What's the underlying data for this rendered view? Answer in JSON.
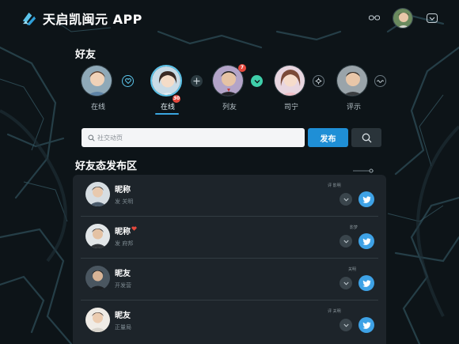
{
  "app": {
    "title": "天启凯闽元 APP"
  },
  "friends_section": {
    "title": "好友",
    "friends": [
      {
        "label": "在线",
        "active": false,
        "badge": ""
      },
      {
        "label": "在线",
        "active": true,
        "badge": "30"
      },
      {
        "label": "列友",
        "active": false,
        "badge": "7"
      },
      {
        "label": "司宁",
        "active": false,
        "badge": ""
      },
      {
        "label": "评示",
        "active": false,
        "badge": ""
      }
    ]
  },
  "search": {
    "placeholder": "社交动页",
    "value": ""
  },
  "publish_button": {
    "label": "发布"
  },
  "feed": {
    "title": "好友态发布区",
    "posts": [
      {
        "nickname": "昵称",
        "sub": "发 关明",
        "meta": "评 影明"
      },
      {
        "nickname": "昵称",
        "sub": "发 府邦",
        "meta": "影梦"
      },
      {
        "nickname": "昵友",
        "sub": "开发营",
        "meta": "关明"
      },
      {
        "nickname": "昵友",
        "sub": "正量局",
        "meta": "评 关明"
      }
    ]
  },
  "colors": {
    "background": "#0d1418",
    "accent": "#1f8fd6",
    "panel": "#1e262c",
    "badge": "#e5483d",
    "active_ring": "#5cc4ea"
  },
  "icons": {
    "logo": "app-logo-icon",
    "top_right": [
      "glasses-icon",
      "user-avatar",
      "chevron-down-icon"
    ],
    "friend_row": [
      "heart-circle-icon",
      "plus-icon",
      "chevron-down-circle-icon",
      "settings-circle-icon",
      "wave-circle-icon"
    ],
    "post_actions": [
      "chevron-down-icon",
      "bird-icon"
    ]
  }
}
